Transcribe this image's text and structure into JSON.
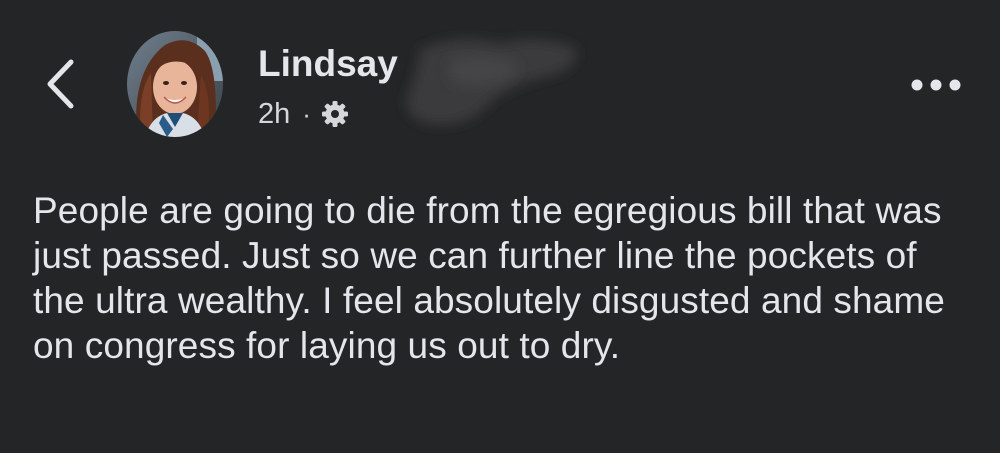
{
  "header": {
    "back_icon": "chevron-left-icon",
    "author": {
      "name": "Lindsay",
      "avatar": "profile-photo"
    },
    "meta": {
      "time": "2h",
      "separator": "·",
      "audience_icon": "gear-icon"
    },
    "more_icon": "ellipsis-horizontal-icon"
  },
  "post": {
    "text": "People are going to die from the egregious bill that was just passed. Just so we can further line the pockets of the ultra wealthy. I feel absolutely disgusted and shame on congress for laying us out to dry."
  },
  "colors": {
    "background": "#242526",
    "primary_text": "#e4e6eb",
    "secondary_text": "#d5d7db"
  }
}
